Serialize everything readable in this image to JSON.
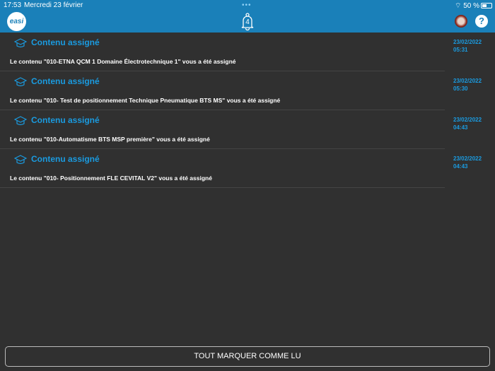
{
  "status": {
    "time": "17:53",
    "date": "Mercredi 23 février",
    "battery": "50 %"
  },
  "header": {
    "logo": "easi",
    "badge_count": "4",
    "help": "?"
  },
  "notifications": [
    {
      "title": "Contenu assigné",
      "body": "Le contenu \"010-ETNA QCM 1 Domaine Électrotechnique 1\" vous a été assigné",
      "date": "23/02/2022",
      "time": "05:31"
    },
    {
      "title": "Contenu assigné",
      "body": "Le contenu \"010- Test de positionnement Technique Pneumatique BTS MS\" vous a été assigné",
      "date": "23/02/2022",
      "time": "05:30"
    },
    {
      "title": "Contenu assigné",
      "body": "Le contenu \"010-Automatisme BTS MSP première\" vous a été assigné",
      "date": "23/02/2022",
      "time": "04:43"
    },
    {
      "title": "Contenu assigné",
      "body": "Le contenu \"010- Positionnement FLE CEVITAL V2\" vous a été assigné",
      "date": "23/02/2022",
      "time": "04:43"
    }
  ],
  "footer": {
    "mark_all": "TOUT MARQUER COMME LU"
  }
}
